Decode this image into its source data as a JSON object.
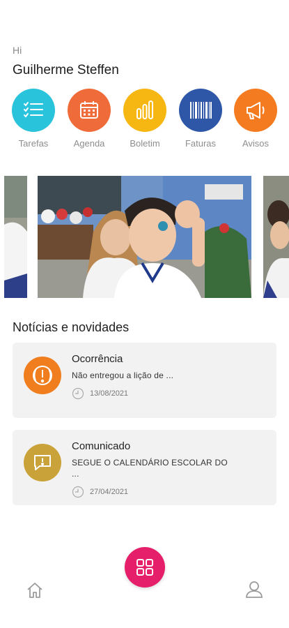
{
  "header": {
    "greeting": "Hi",
    "user_name": "Guilherme Steffen"
  },
  "quick_actions": [
    {
      "label": "Tarefas",
      "icon": "checklist-icon",
      "color": "#29c3dc"
    },
    {
      "label": "Agenda",
      "icon": "calendar-icon",
      "color": "#ef6c3a"
    },
    {
      "label": "Boletim",
      "icon": "bar-chart-icon",
      "color": "#f6b713"
    },
    {
      "label": "Faturas",
      "icon": "barcode-icon",
      "color": "#2f57a7"
    },
    {
      "label": "Avisos",
      "icon": "megaphone-icon",
      "color": "#f47b20"
    }
  ],
  "carousel": {
    "slides": [
      "photo-left-partial",
      "photo-main",
      "photo-right-partial"
    ]
  },
  "news": {
    "title": "Notícias e novidades",
    "items": [
      {
        "title": "Ocorrência",
        "summary": "Não entregou a lição de ...",
        "date": "13/08/2021",
        "icon": "alert-icon",
        "color": "#f07e1f"
      },
      {
        "title": "Comunicado",
        "summary": "SEGUE O CALENDÁRIO ESCOLAR DO ...",
        "date": "27/04/2021",
        "icon": "message-alert-icon",
        "color": "#c9a23a"
      }
    ]
  },
  "nav": {
    "fab_color": "#e61f6a"
  }
}
